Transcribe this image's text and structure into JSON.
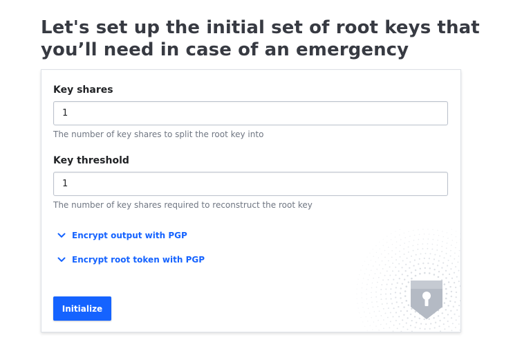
{
  "page": {
    "title": "Let's set up the initial set of root keys that you’ll need in case of an emergency"
  },
  "form": {
    "key_shares": {
      "label": "Key shares",
      "value": "1",
      "help": "The number of key shares to split the root key into"
    },
    "key_threshold": {
      "label": "Key threshold",
      "value": "1",
      "help": "The number of key shares required to reconstruct the root key"
    },
    "toggles": [
      {
        "label": "Encrypt output with PGP",
        "icon": "chevron-down-icon"
      },
      {
        "label": "Encrypt root token with PGP",
        "icon": "chevron-down-icon"
      }
    ],
    "submit_label": "Initialize"
  },
  "colors": {
    "accent": "#1563ff",
    "title": "#373a42",
    "help_text": "#6f7682",
    "shield": "#b4bac4"
  },
  "icons": {
    "decoration": "dotted-halo-decoration",
    "shield": "shield-keyhole-icon"
  }
}
